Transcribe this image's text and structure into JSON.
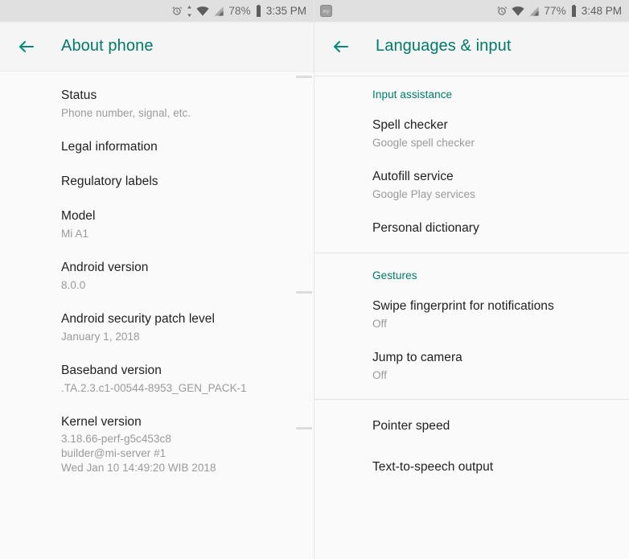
{
  "left_panel": {
    "statusbar": {
      "icons": [
        "alarm-icon",
        "data-transfer-icon",
        "wifi-icon",
        "cell-signal-icon"
      ],
      "battery_percent": "78%",
      "battery_icon": "battery-icon",
      "time": "3:35 PM"
    },
    "appbar": {
      "back_icon": "back-arrow-icon",
      "title": "About phone"
    },
    "rows": [
      {
        "title": "Status",
        "subtitle": "Phone number, signal, etc."
      },
      {
        "title": "Legal information",
        "subtitle": ""
      },
      {
        "title": "Regulatory labels",
        "subtitle": ""
      },
      {
        "title": "Model",
        "subtitle": "Mi A1"
      },
      {
        "title": "Android version",
        "subtitle": "8.0.0"
      },
      {
        "title": "Android security patch level",
        "subtitle": "January 1, 2018"
      },
      {
        "title": "Baseband version",
        "subtitle": ".TA.2.3.c1-00544-8953_GEN_PACK-1"
      },
      {
        "title": "Kernel version",
        "subtitle": "3.18.66-perf-g5c453c8\nbuilder@mi-server #1\nWed Jan 10 14:49:20 WIB 2018"
      }
    ]
  },
  "right_panel": {
    "statusbar": {
      "notification_icon": "my-app-notification-icon",
      "notification_label": "my",
      "icons": [
        "alarm-icon",
        "wifi-icon",
        "cell-signal-icon"
      ],
      "battery_percent": "77%",
      "battery_icon": "battery-icon",
      "time": "3:48 PM"
    },
    "appbar": {
      "back_icon": "back-arrow-icon",
      "title": "Languages & input"
    },
    "sections": [
      {
        "header": "Input assistance",
        "rows": [
          {
            "title": "Spell checker",
            "subtitle": "Google spell checker"
          },
          {
            "title": "Autofill service",
            "subtitle": "Google Play services"
          },
          {
            "title": "Personal dictionary",
            "subtitle": ""
          }
        ]
      },
      {
        "header": "Gestures",
        "rows": [
          {
            "title": "Swipe fingerprint for notifications",
            "subtitle": "Off"
          },
          {
            "title": "Jump to camera",
            "subtitle": "Off"
          }
        ]
      },
      {
        "header": "",
        "rows": [
          {
            "title": "Pointer speed",
            "subtitle": ""
          },
          {
            "title": "Text-to-speech output",
            "subtitle": ""
          }
        ]
      }
    ]
  },
  "colors": {
    "accent_teal": "#00796b",
    "statusbar_bg": "#e0e0e0",
    "appbar_bg": "#f5f5f5",
    "body_bg": "#fafafa",
    "title_text": "#212121",
    "subtitle_text": "#9a9a9a"
  }
}
